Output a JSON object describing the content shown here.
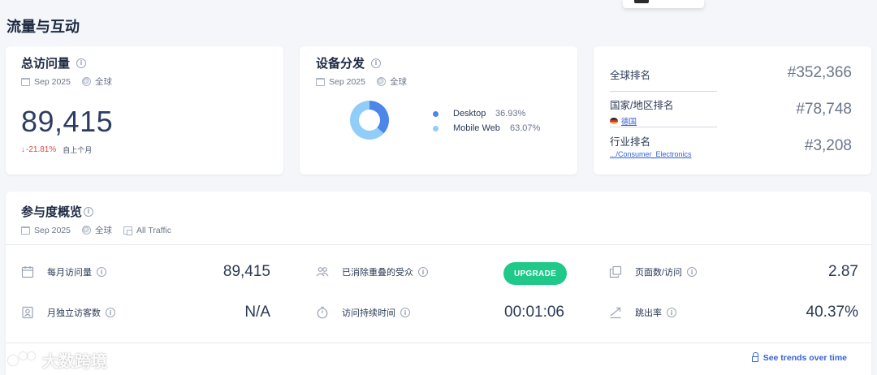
{
  "page_title": "流量与互动",
  "total_visits": {
    "title": "总访问量",
    "date": "Sep 2025",
    "region": "全球",
    "value": "89,415",
    "change": "-21.81%",
    "since": "自上个月"
  },
  "device_distribution": {
    "title": "设备分发",
    "date": "Sep 2025",
    "region": "全球",
    "items": [
      {
        "name": "Desktop",
        "pct": "36.93%",
        "color": "#4c86e8",
        "value": 36.93
      },
      {
        "name": "Mobile Web",
        "pct": "63.07%",
        "color": "#91cdf9",
        "value": 63.07
      }
    ]
  },
  "ranks": {
    "global_label": "全球排名",
    "global_value": "#352,366",
    "country_label": "国家/地区排名",
    "country_name": "德国",
    "country_value": "#78,748",
    "industry_label": "行业排名",
    "industry_name": ".../Consumer_Electronics",
    "industry_value": "#3,208"
  },
  "engagement": {
    "title": "参与度概览",
    "date": "Sep 2025",
    "region": "全球",
    "traffic": "All Traffic",
    "metrics": {
      "monthly_visits_label": "每月访问量",
      "monthly_visits_value": "89,415",
      "unique_visitors_label": "月独立访客数",
      "unique_visitors_value": "N/A",
      "dedup_audience_label": "已消除重叠的受众",
      "upgrade_label": "UPGRADE",
      "visit_duration_label": "访问持续时间",
      "visit_duration_value": "00:01:06",
      "pages_per_visit_label": "页面数/访问",
      "pages_per_visit_value": "2.87",
      "bounce_rate_label": "跳出率",
      "bounce_rate_value": "40.37%"
    },
    "trends_link": "See trends over time"
  },
  "watermark": "大数跨境"
}
